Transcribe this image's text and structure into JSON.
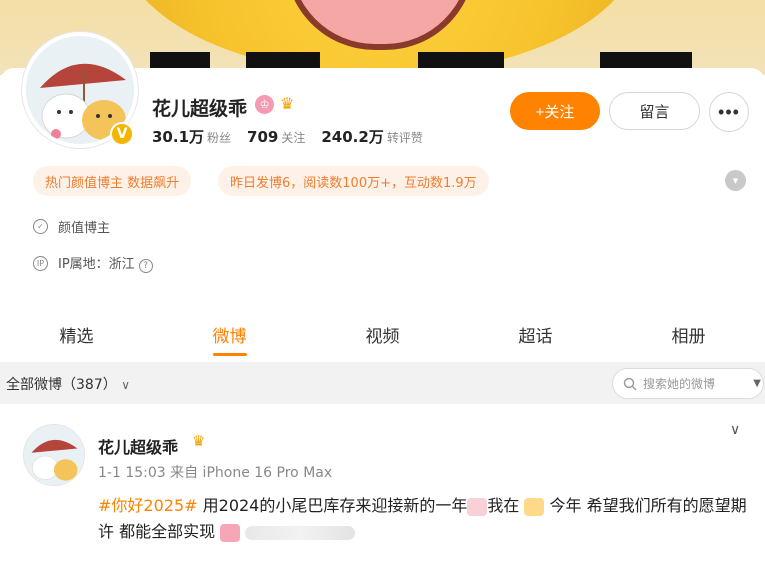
{
  "profile": {
    "name": "花儿超级乖",
    "followers_num": "30.1万",
    "followers_lbl": "粉丝",
    "following_num": "709",
    "following_lbl": "关注",
    "reposts_num": "240.2万",
    "reposts_lbl": "转评赞",
    "follow_label": "+关注",
    "message_label": "留言",
    "more_label": "•••"
  },
  "tags": {
    "hot": "热门颜值博主 数据飙升",
    "stats": "昨日发博6，阅读数100万+，互动数1.9万"
  },
  "info": {
    "category": "颜值博主",
    "ip": "IP属地：浙江",
    "ip_icon": "IP"
  },
  "tabs": [
    "精选",
    "微博",
    "视频",
    "超话",
    "相册"
  ],
  "filter": {
    "label": "全部微博（387）",
    "search_placeholder": "搜索她的微博"
  },
  "post": {
    "author": "花儿超级乖",
    "meta": "1-1 15:03 来自 iPhone 16 Pro Max",
    "topic": "#你好2025#",
    "text_a": " 用2024的小尾巴库存来迎接新的一年",
    "text_b": "我在 ",
    "text_c": " 今年 希望我们所有的愿望期许 都能全部实现"
  },
  "colors": {
    "accent": "#ff8200",
    "tag_bg": "#fdf1e8",
    "tag_text": "#ef7d2e",
    "verify": "#f4b400"
  },
  "icons": {
    "verify": "verified-v-icon",
    "crown": "crown-icon",
    "shield": "shield-icon",
    "search": "search-icon",
    "chevron": "chevron-down-icon"
  }
}
